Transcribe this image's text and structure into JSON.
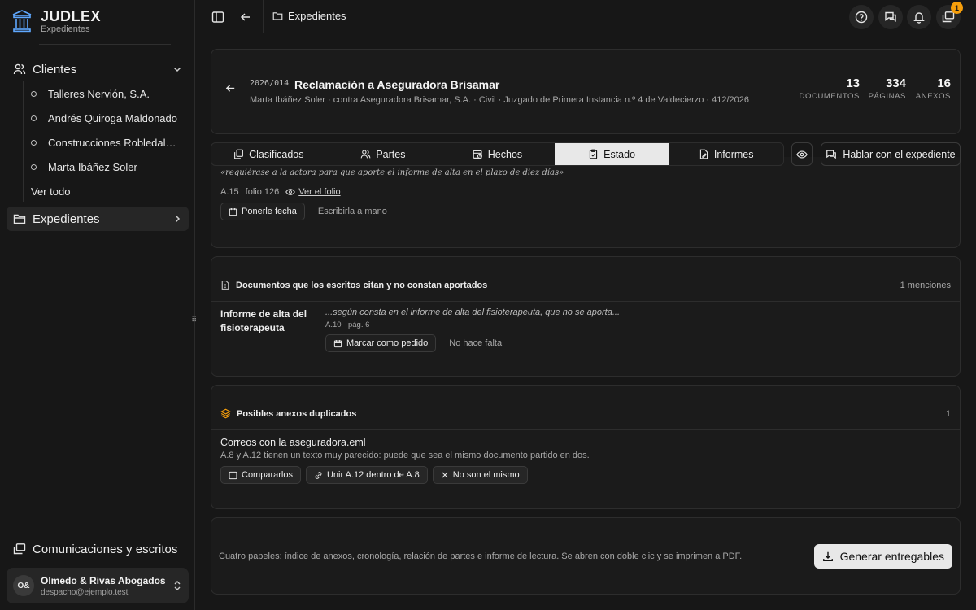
{
  "app": {
    "name": "JUDLEX",
    "subtitle": "Expedientes"
  },
  "sidebar": {
    "clientes_label": "Clientes",
    "clientes": [
      "Talleres Nervión, S.A.",
      "Andrés Quiroga Maldonado",
      "Construcciones Robledal, S.L.",
      "Marta Ibáñez Soler"
    ],
    "ver_todo": "Ver todo",
    "expedientes_label": "Expedientes",
    "comunicaciones_label": "Comunicaciones y escritos",
    "account": {
      "initials": "O&",
      "name": "Olmedo & Rivas Abogados",
      "email": "despacho@ejemplo.test"
    }
  },
  "topbar": {
    "breadcrumb": "Expedientes",
    "notification_count": "1"
  },
  "case": {
    "code": "2026/014",
    "title": "Reclamación a Aseguradora Brisamar",
    "meta": "Marta Ibáñez Soler · contra Aseguradora Brisamar, S.A. · Civil · Juzgado de Primera Instancia n.º 4 de Valdecierzo · 412/2026",
    "stats": [
      {
        "num": "13",
        "label": "DOCUMENTOS"
      },
      {
        "num": "334",
        "label": "PÁGINAS"
      },
      {
        "num": "16",
        "label": "ANEXOS"
      }
    ]
  },
  "tabs": [
    "Clasificados",
    "Partes",
    "Hechos",
    "Estado",
    "Informes"
  ],
  "active_tab": "Estado",
  "talk_button": "Hablar con el expediente",
  "deadline_item": {
    "quote": "«requiérase a la actora para que aporte el informe de alta en el plazo de diez días»",
    "ref": "A.15",
    "folio": "folio 126",
    "link": "Ver el folio",
    "primary_action": "Ponerle fecha",
    "secondary_action": "Escribirla a mano"
  },
  "missing_docs": {
    "title": "Documentos que los escritos citan y no constan aportados",
    "count": "1 menciones",
    "item_name": "Informe de alta del fisioterapeuta",
    "item_quote": "...según consta en el informe de alta del fisioterapeuta, que no se aporta...",
    "item_ref": "A.10 · pág. 6",
    "primary_action": "Marcar como pedido",
    "secondary_action": "No hace falta"
  },
  "duplicates": {
    "title": "Posibles anexos duplicados",
    "count": "1",
    "item_title": "Correos con la aseguradora.eml",
    "item_desc": "A.8 y A.12 tienen un texto muy parecido: puede que sea el mismo documento partido en dos.",
    "actions": [
      "Compararlos",
      "Unir A.12 dentro de A.8",
      "No son el mismo"
    ]
  },
  "footer": {
    "text": "Cuatro papeles: índice de anexos, cronología, relación de partes e informe de lectura. Se abren con doble clic y se imprimen a PDF.",
    "button": "Generar entregables"
  },
  "colors": {
    "background": "#171717",
    "card": "#1b1b1b",
    "accent_badge": "#f59e0b",
    "active_tab": "#e8e8e8"
  }
}
